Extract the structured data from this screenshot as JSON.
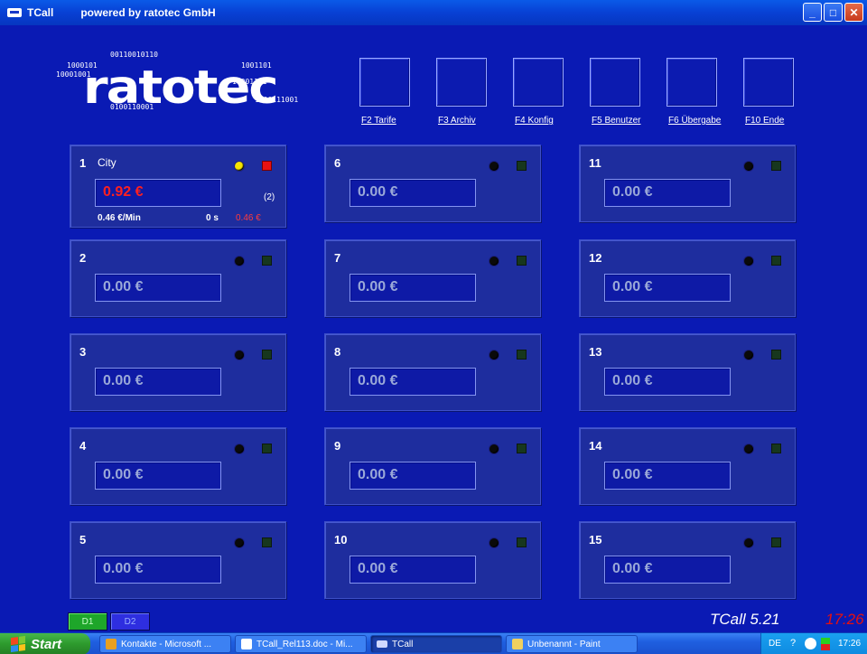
{
  "window": {
    "app_name": "TCall",
    "powered_by": "powered by ratotec GmbH",
    "controls": {
      "minimize": "_",
      "maximize": "□",
      "close": "✕"
    }
  },
  "logo": {
    "word": "ratotec",
    "bits": [
      "00110010110",
      "1000101",
      "10001001",
      "1001101",
      "10001101",
      "0100110001",
      "1000111001"
    ]
  },
  "fkeys": [
    "F2 Tarife",
    "F3 Archiv",
    "F4 Konfig",
    "F5 Benutzer",
    "F6 Übergabe",
    "F10 Ende"
  ],
  "panels": [
    {
      "num": "1",
      "name": "City",
      "amount": "0.92 €",
      "count": "(2)",
      "rate": "0.46 €/Min",
      "duration": "0 s",
      "cost": "0.46 €",
      "active": true
    },
    {
      "num": "2",
      "amount": "0.00 €"
    },
    {
      "num": "3",
      "amount": "0.00 €"
    },
    {
      "num": "4",
      "amount": "0.00 €"
    },
    {
      "num": "5",
      "amount": "0.00 €"
    },
    {
      "num": "6",
      "amount": "0.00 €"
    },
    {
      "num": "7",
      "amount": "0.00 €"
    },
    {
      "num": "8",
      "amount": "0.00 €"
    },
    {
      "num": "9",
      "amount": "0.00 €"
    },
    {
      "num": "10",
      "amount": "0.00 €"
    },
    {
      "num": "11",
      "amount": "0.00 €"
    },
    {
      "num": "12",
      "amount": "0.00 €"
    },
    {
      "num": "13",
      "amount": "0.00 €"
    },
    {
      "num": "14",
      "amount": "0.00 €"
    },
    {
      "num": "15",
      "amount": "0.00 €"
    }
  ],
  "dbuttons": {
    "d1": "D1",
    "d2": "D2"
  },
  "version": "TCall  5.21",
  "clock": "17:26",
  "taskbar": {
    "start": "Start",
    "tasks": [
      "Kontakte - Microsoft ...",
      "TCall_Rel113.doc - Mi...",
      "TCall",
      "Unbenannt - Paint"
    ],
    "lang": "DE",
    "time": "17:26"
  },
  "colors": {
    "background": "#0a1ab4",
    "panel": "#1e2d9e",
    "active_amount": "#ff2020",
    "clock": "#e41010"
  }
}
